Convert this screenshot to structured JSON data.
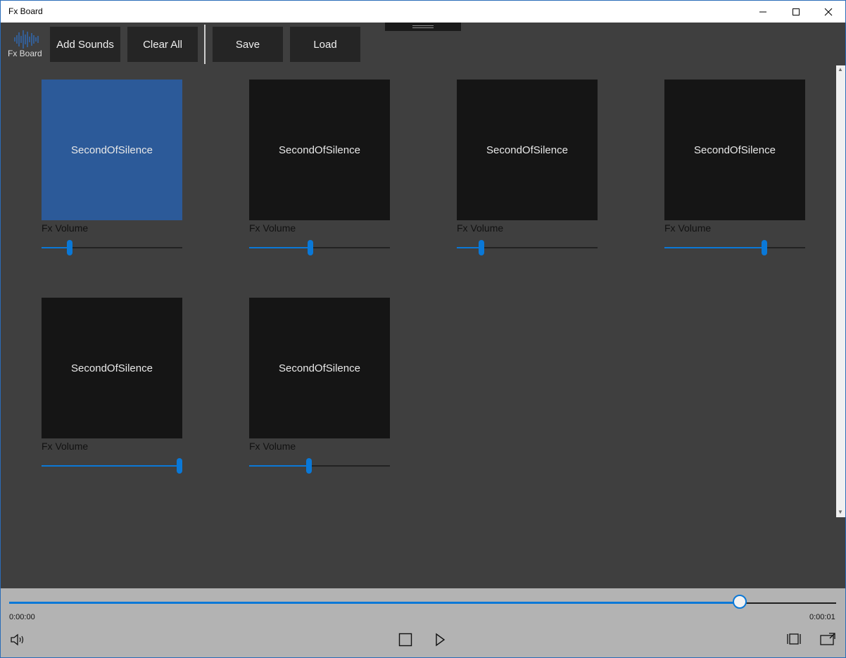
{
  "window": {
    "title": "Fx Board"
  },
  "logo": {
    "text": "Fx Board"
  },
  "toolbar": {
    "add_sounds": "Add Sounds",
    "clear_all": "Clear All",
    "save": "Save",
    "load": "Load"
  },
  "tiles": [
    {
      "name": "SecondOfSilence",
      "volume_label": "Fx Volume",
      "volume": 0.2,
      "selected": true
    },
    {
      "name": "SecondOfSilence",
      "volume_label": "Fx Volume",
      "volume": 0.435,
      "selected": false
    },
    {
      "name": "SecondOfSilence",
      "volume_label": "Fx Volume",
      "volume": 0.175,
      "selected": false
    },
    {
      "name": "SecondOfSilence",
      "volume_label": "Fx Volume",
      "volume": 0.71,
      "selected": false
    },
    {
      "name": "SecondOfSilence",
      "volume_label": "Fx Volume",
      "volume": 0.98,
      "selected": false
    },
    {
      "name": "SecondOfSilence",
      "volume_label": "Fx Volume",
      "volume": 0.425,
      "selected": false
    }
  ],
  "player": {
    "position": 0.883,
    "time_current": "0:00:00",
    "time_total": "0:00:01",
    "icons": {
      "volume": "speaker-icon",
      "stop": "stop-icon",
      "play": "play-icon",
      "zoom": "zoom-icon",
      "cast": "cast-icon"
    }
  },
  "colors": {
    "accent": "#0a78d7",
    "selected_tile": "#2c5a99",
    "tile": "#151515",
    "background": "#3f3f3f"
  }
}
